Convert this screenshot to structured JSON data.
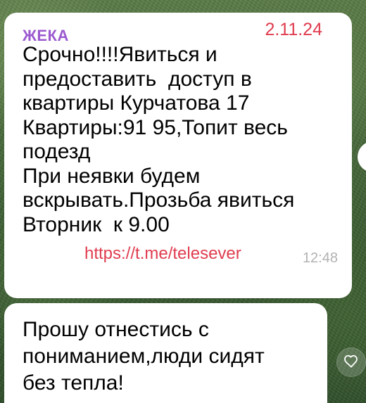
{
  "chat": {
    "messages": [
      {
        "sender": "ЖЕКА",
        "date": "2.11.24",
        "text": "Срочно!!!!Явиться и\nпредоставить  доступ в\nквартиры Курчатова 17\nКвартиры:91 95,Топит весь\nподезд\nПри неявки будем\nвскрывать.Прозьба явиться\nВторник  к 9.00",
        "link": "https://t.me/telesever",
        "time": "12:48"
      },
      {
        "text": "Прошу отнестись с\nпониманием,люди сидят\nбез тепла!"
      }
    ]
  },
  "colors": {
    "sender": "#9b59d0",
    "date": "#e03c4f",
    "link": "#e03c4f",
    "time": "#b2b2b2"
  },
  "icons": {
    "reaction": "heart-icon"
  }
}
